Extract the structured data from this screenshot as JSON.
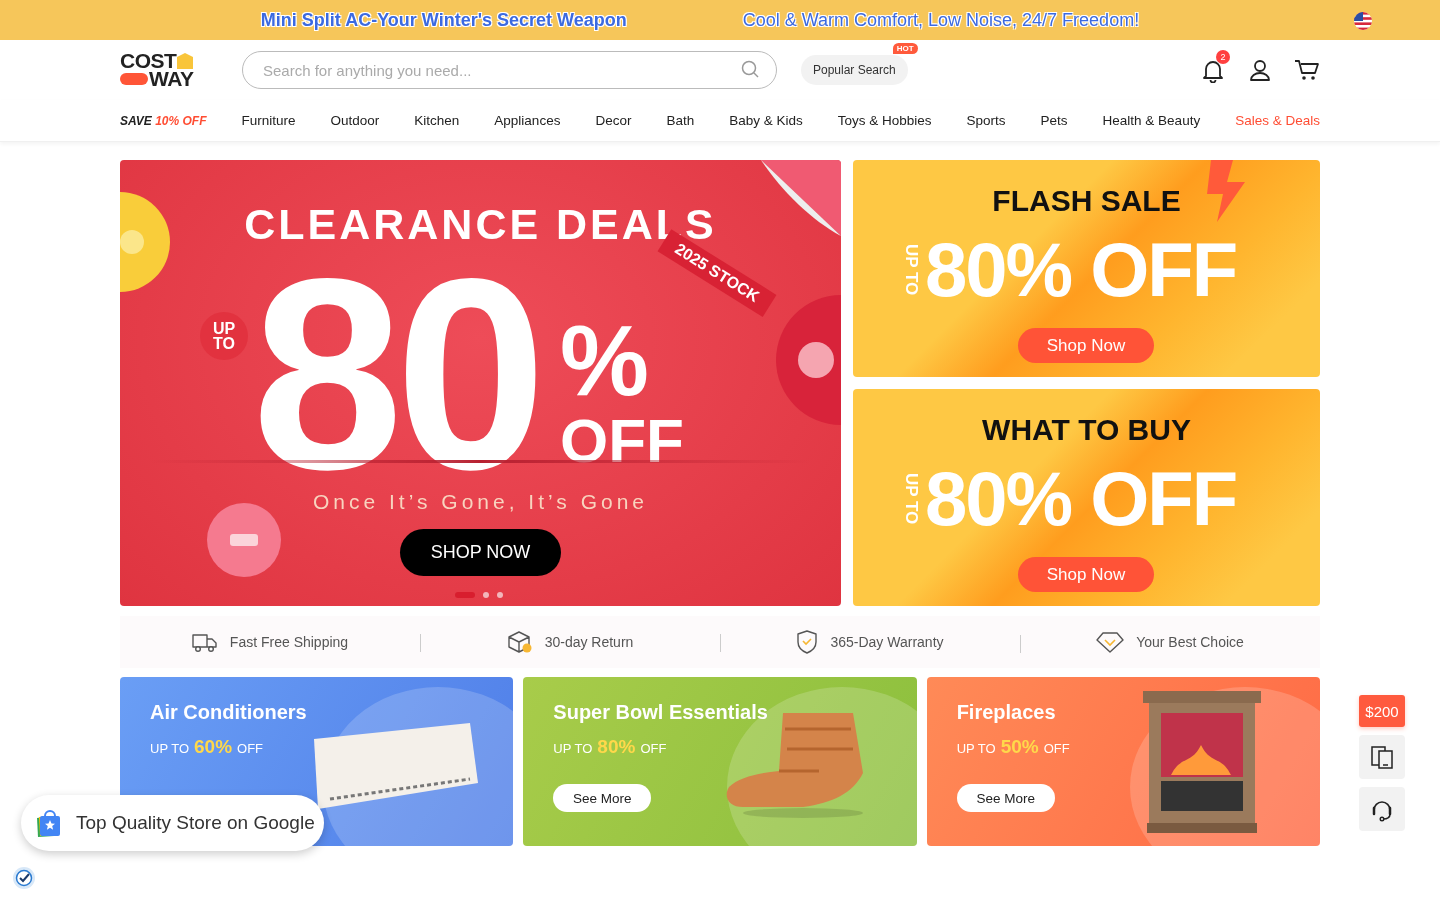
{
  "promo_bar": {
    "messages": [
      "Mini Split AC-Your Winter's Secret Weapon",
      "Cool & Warm Comfort, Low Noise, 24/7 Freedom!"
    ]
  },
  "header": {
    "logo": [
      "COST",
      "WAY"
    ],
    "search": {
      "placeholder": "Search for anything you need..."
    },
    "popular_search": {
      "label": "Popular Search",
      "badge": "HOT"
    },
    "notifications": {
      "count": "2"
    }
  },
  "nav": {
    "promo": {
      "label": "SAVE",
      "accent": "10% OFF"
    },
    "items": [
      {
        "label": "Furniture",
        "kind": "normal"
      },
      {
        "label": "Outdoor",
        "kind": "normal"
      },
      {
        "label": "Kitchen",
        "kind": "normal"
      },
      {
        "label": "Appliances",
        "kind": "normal"
      },
      {
        "label": "Decor",
        "kind": "normal"
      },
      {
        "label": "Bath",
        "kind": "normal"
      },
      {
        "label": "Baby & Kids",
        "kind": "normal"
      },
      {
        "label": "Toys & Hobbies",
        "kind": "normal"
      },
      {
        "label": "Sports",
        "kind": "normal"
      },
      {
        "label": "Pets",
        "kind": "normal"
      },
      {
        "label": "Health & Beauty",
        "kind": "normal"
      },
      {
        "label": "Sales & Deals",
        "kind": "highlight"
      }
    ]
  },
  "hero": {
    "title": "CLEARANCE DEALS",
    "up_to": [
      "UP",
      "TO"
    ],
    "amount": "80",
    "percent": "%",
    "off": "OFF",
    "ribbon": "2025 STOCK",
    "tagline": "Once It’s Gone, It’s Gone",
    "button": "SHOP NOW",
    "dots": [
      {
        "selected": true
      },
      {
        "selected": false
      },
      {
        "selected": false
      }
    ]
  },
  "side_banners": [
    {
      "title": "FLASH SALE",
      "up_to": "UP TO",
      "discount": "80% OFF",
      "button": "Shop Now"
    },
    {
      "title": "WHAT TO BUY",
      "up_to": "UP TO",
      "discount": "80% OFF",
      "button": "Shop Now"
    }
  ],
  "features": [
    {
      "label": "Fast Free Shipping"
    },
    {
      "label": "30-day Return"
    },
    {
      "label": "365-Day Warranty"
    },
    {
      "label": "Your Best Choice"
    }
  ],
  "categories": [
    {
      "title": "Air Conditioners",
      "prefix": "UP TO",
      "discount": "60%",
      "suffix": "OFF"
    },
    {
      "title": "Super Bowl Essentials",
      "prefix": "UP TO",
      "discount": "80%",
      "suffix": "OFF",
      "button": "See More"
    },
    {
      "title": "Fireplaces",
      "prefix": "UP TO",
      "discount": "50%",
      "suffix": "OFF",
      "button": "See More"
    }
  ],
  "side_tools": {
    "coupon": "$200"
  },
  "google_badge": {
    "text": "Top Quality Store on Google"
  }
}
